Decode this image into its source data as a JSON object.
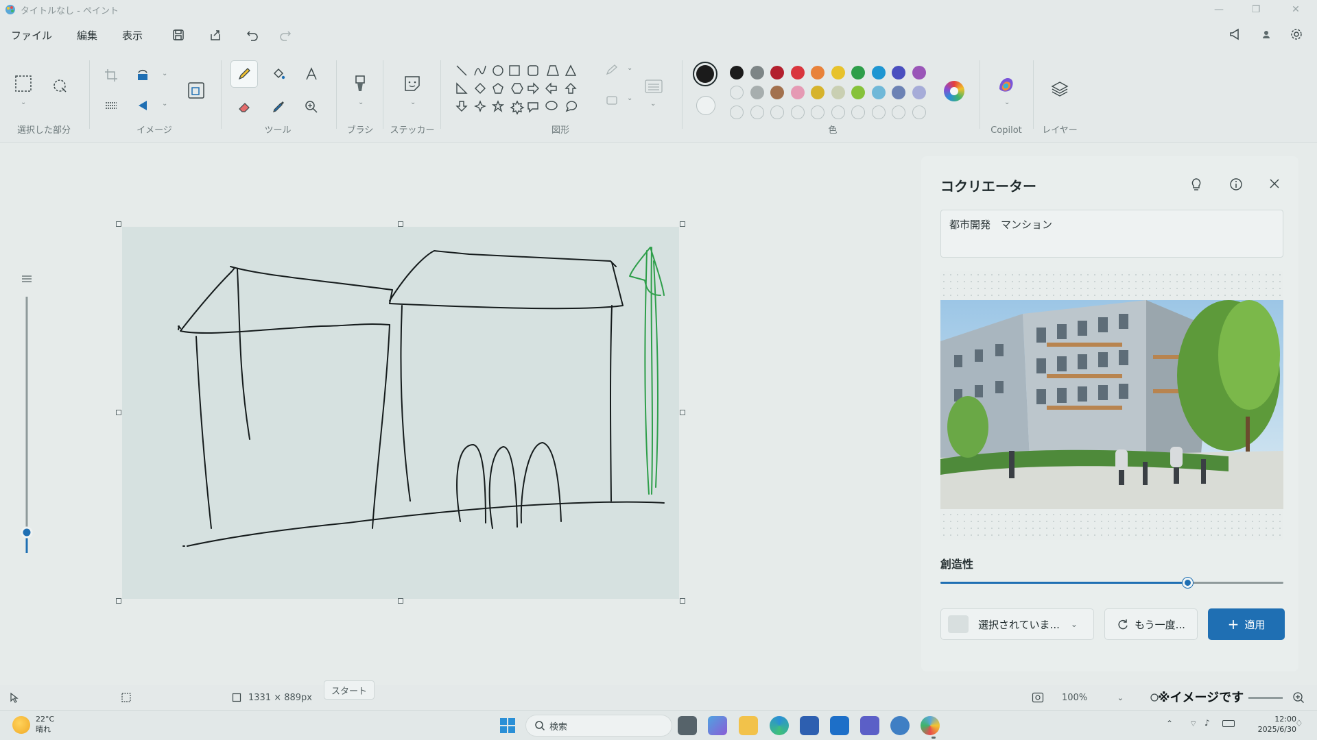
{
  "window": {
    "title": "タイトルなし - ペイント",
    "minimize_glyph": "—",
    "restore_glyph": "❐",
    "close_glyph": "✕"
  },
  "menu": {
    "file": "ファイル",
    "edit": "編集",
    "view": "表示"
  },
  "ribbon": {
    "groups": {
      "selection": "選択した部分",
      "image": "イメージ",
      "tools": "ツール",
      "brush": "ブラシ",
      "stickers": "ステッカー",
      "shapes": "図形",
      "colors": "色",
      "copilot": "Copilot",
      "layers": "レイヤー"
    },
    "active_tool": "pencil",
    "primary_color": "#1b1b1b",
    "secondary_color": "#ffffff",
    "palette_row1": [
      "#1b1b1b",
      "#7d8586",
      "#b3202e",
      "#d9363e",
      "#e8823a",
      "#e7c22c",
      "#2e9e4a",
      "#1e96d2",
      "#4a4fbf",
      "#9a56b8"
    ],
    "palette_row2": [
      "",
      "#a7aeae",
      "#a2714e",
      "#e59ab4",
      "#d6b32c",
      "#c9cfb2",
      "#86c23a",
      "#6fb8d8",
      "#6c82b4",
      "#a6acd8"
    ],
    "palette_row3_empty_count": 10
  },
  "canvas": {
    "size": "1331 × 889px"
  },
  "cocreator": {
    "title": "コクリエーター",
    "prompt": "都市開発　マンション",
    "creativity_label": "創造性",
    "creativity_value": 0.72,
    "style_select": "選択されていま...",
    "retry_label": "もう一度...",
    "apply_label": "適用"
  },
  "statusbar": {
    "zoom": "100%",
    "tooltip": "スタート",
    "watermark": "※イメージです"
  },
  "taskbar": {
    "weather_temp": "22°C",
    "weather_desc": "晴れ",
    "search": "検索",
    "time": "12:00",
    "date": "2025/6/30"
  },
  "icons": {
    "save": "save-icon",
    "share": "share-icon",
    "undo": "undo-icon",
    "redo": "redo-icon"
  }
}
